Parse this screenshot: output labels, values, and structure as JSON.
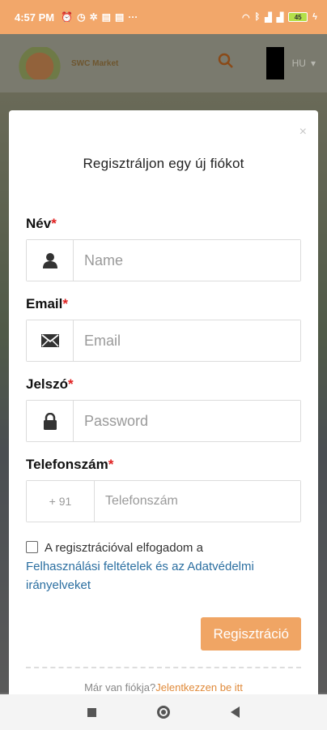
{
  "status_bar": {
    "time": "4:57 PM",
    "left_icons": [
      "alarm-icon",
      "clock-icon",
      "settings-icon",
      "message-icon",
      "message-icon",
      "more-icon"
    ],
    "battery_level": "45"
  },
  "header": {
    "logo_text": "SWC Market",
    "language": "HU"
  },
  "modal": {
    "close_symbol": "×",
    "title": "Regisztráljon egy új fiókot",
    "name": {
      "label": "Név",
      "placeholder": "Name"
    },
    "email": {
      "label": "Email",
      "placeholder": "Email"
    },
    "password": {
      "label": "Jelszó",
      "placeholder": "Password"
    },
    "phone": {
      "label": "Telefonszám",
      "country_code": "+ 91",
      "placeholder": "Telefonszám"
    },
    "required_mark": "*",
    "terms": {
      "text": "A regisztrációval elfogadom a",
      "link": "Felhasználási feltételek és az Adatvédelmi irányelveket",
      "checked": false
    },
    "submit_label": "Regisztráció",
    "login_prompt": "Már van fiókja?",
    "login_link": "Jelentkezzen be itt"
  },
  "colors": {
    "accent": "#f0a564",
    "status_bar": "#f2a76a",
    "link": "#2a6ea0",
    "required": "#e02020"
  }
}
